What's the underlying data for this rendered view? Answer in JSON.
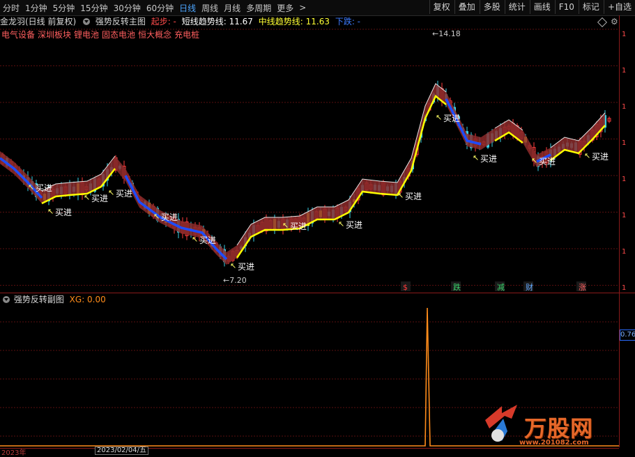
{
  "toolbar": {
    "timeframes": [
      "分时",
      "1分钟",
      "5分钟",
      "15分钟",
      "30分钟",
      "60分钟",
      "日线",
      "周线",
      "月线",
      "多周期",
      "更多"
    ],
    "active": "日线",
    "right_buttons": [
      "复权",
      "叠加",
      "多股",
      "统计",
      "画线",
      "F10",
      "标记",
      "+自选"
    ]
  },
  "info_line": {
    "stock": "金龙羽(日线 前复权)",
    "indicator": "强势反转主图",
    "signal": "起步: -",
    "short_label": "短线趋势线: 11.67",
    "mid_label": "中线趋势线: 11.63",
    "down_label": "下跌: -"
  },
  "concepts": [
    "电气设备",
    "深圳板块",
    "锂电池",
    "固态电池",
    "恒大概念",
    "充电桩"
  ],
  "sub_panel": {
    "name": "强势反转副图",
    "xg": "XG: 0.00",
    "side_value": "0.76"
  },
  "markers": {
    "high": "14.18",
    "low": "7.20",
    "buy": "买进",
    "events": [
      "$",
      "跌",
      "减",
      "财",
      "涨"
    ]
  },
  "bottom_axis": {
    "year": "2023年",
    "date": "2023/02/04/五"
  },
  "watermark": {
    "text": "万股网",
    "url": "www.201082.com"
  },
  "colors": {
    "up": "#ff3b3b",
    "down": "#3ad1e6",
    "short_trend": "#ffff00",
    "down_trend": "#1e4cff",
    "band": "#8b2a2a",
    "sub_line": "#ff8c1a"
  }
}
